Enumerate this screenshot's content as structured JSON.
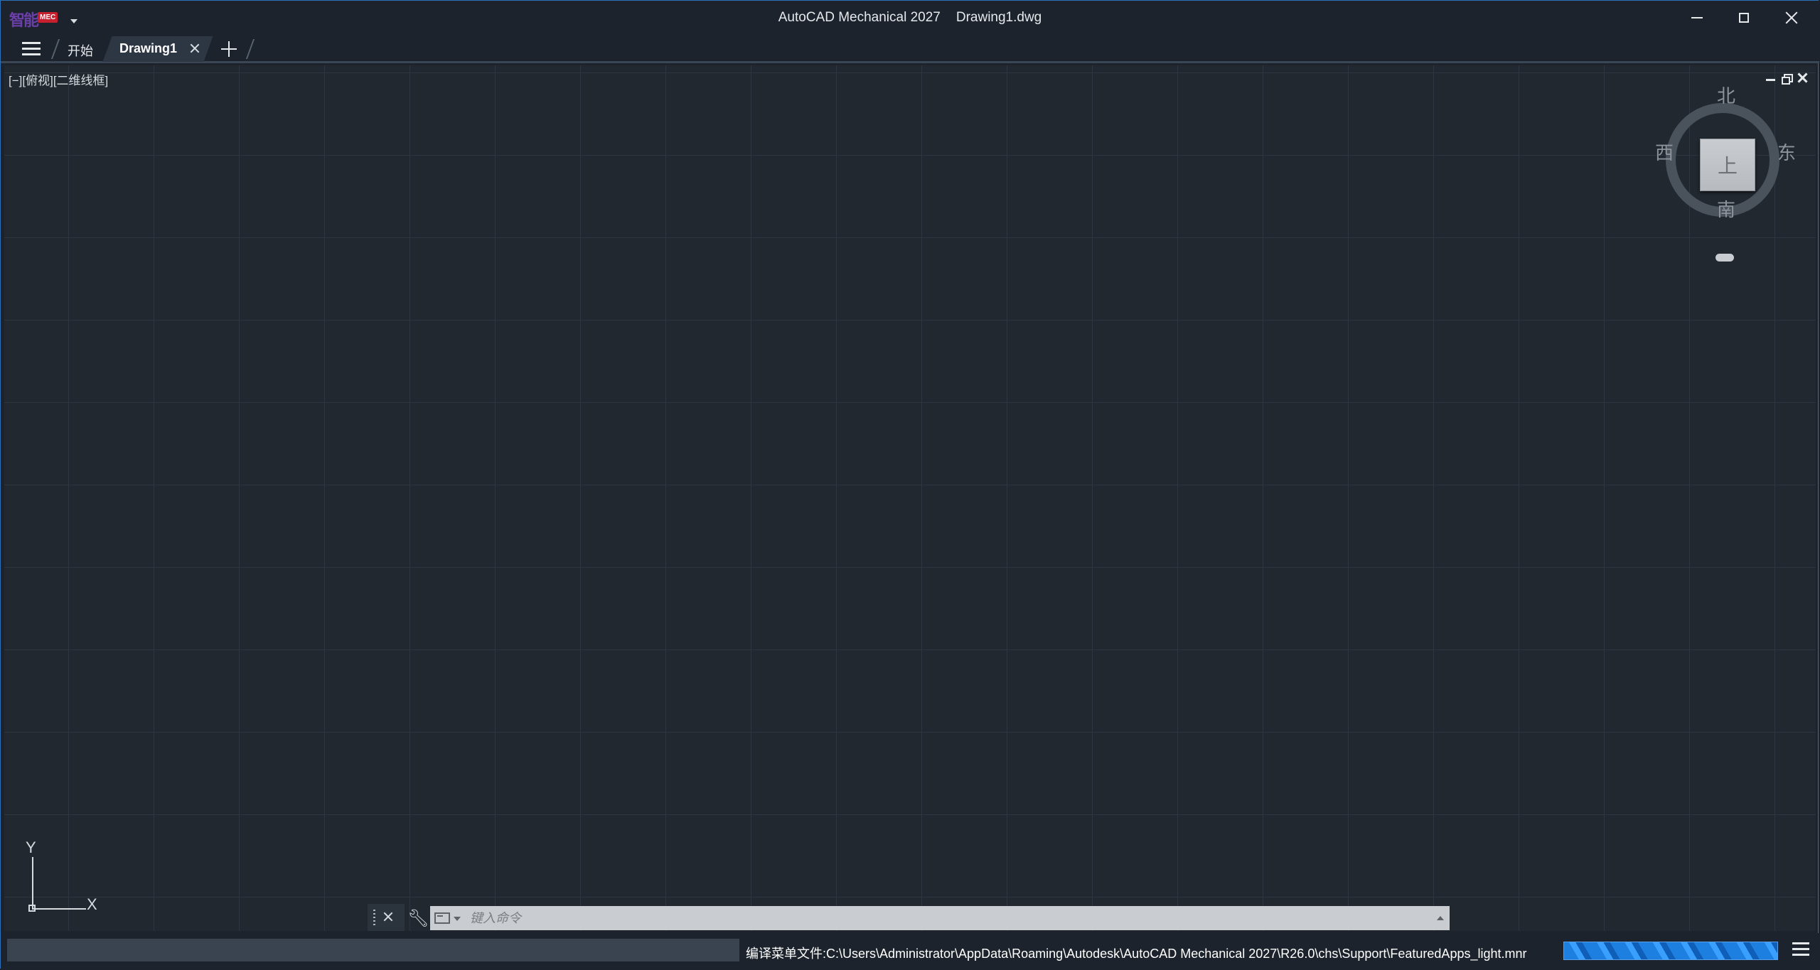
{
  "app": {
    "logo_text": "智能",
    "logo_badge": "MEC",
    "title_app": "AutoCAD Mechanical 2027",
    "title_file": "Drawing1.dwg"
  },
  "tabs": [
    {
      "label": "开始",
      "active": false
    },
    {
      "label": "Drawing1",
      "active": true
    }
  ],
  "viewport": {
    "view_label": "[−][俯视][二维线框]"
  },
  "viewcube": {
    "north": "北",
    "south": "南",
    "west": "西",
    "east": "东",
    "top_face": "上"
  },
  "ucs": {
    "x_label": "X",
    "y_label": "Y"
  },
  "command_line": {
    "placeholder": "键入命令"
  },
  "statusbar": {
    "message": "编译菜单文件:C:\\Users\\Administrator\\AppData\\Roaming\\Autodesk\\AutoCAD Mechanical 2027\\R26.0\\chs\\Support\\FeaturedApps_light.mnr",
    "progress_percent": 100
  },
  "colors": {
    "background": "#1c232d",
    "viewport": "#212830",
    "accent_blue": "#1d7fe0",
    "frame_border": "#2d6fb8"
  },
  "icons": {
    "menu": "hamburger-icon",
    "close": "close-icon",
    "add": "plus-icon",
    "wrench": "wrench-icon",
    "command": "command-window-icon"
  }
}
